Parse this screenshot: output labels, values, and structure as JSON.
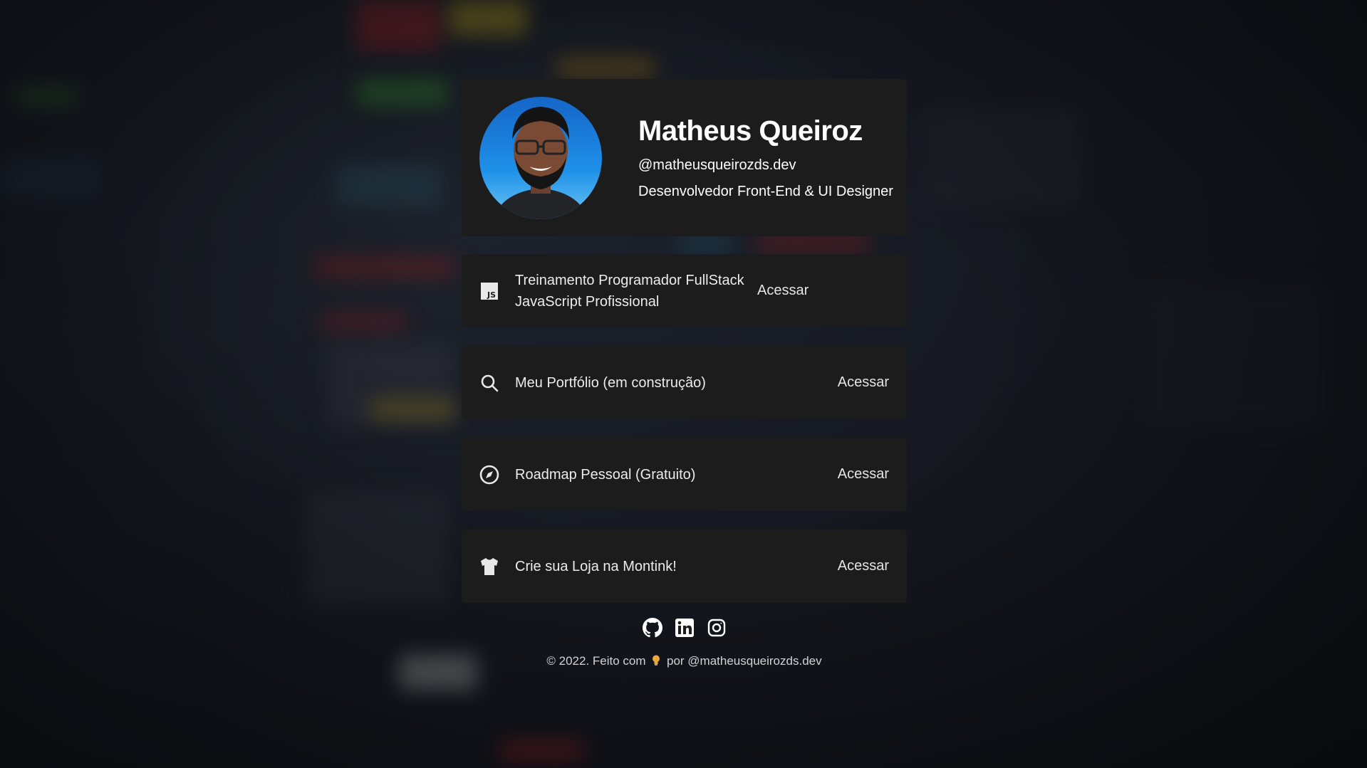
{
  "profile": {
    "name": "Matheus Queiroz",
    "handle": "@matheusqueirozds.dev",
    "role": "Desenvolvedor Front-End & UI Designer"
  },
  "links": [
    {
      "label": "Treinamento Programador FullStack JavaScript Profissional",
      "action": "Acessar",
      "icon": "js-icon"
    },
    {
      "label": "Meu Portfólio (em construção)",
      "action": "Acessar",
      "icon": "search-icon"
    },
    {
      "label": "Roadmap Pessoal (Gratuito)",
      "action": "Acessar",
      "icon": "compass-icon"
    },
    {
      "label": "Crie sua Loja na Montink!",
      "action": "Acessar",
      "icon": "tshirt-icon"
    }
  ],
  "socials": [
    {
      "icon": "github-icon"
    },
    {
      "icon": "linkedin-icon"
    },
    {
      "icon": "instagram-icon"
    }
  ],
  "footer": {
    "prefix": "© 2022. Feito com",
    "suffix": "por @matheusqueirozds.dev"
  },
  "colors": {
    "card_background": "#1c1c1d",
    "text": "#ffffff",
    "avatar_sky": "#1e90e8"
  }
}
